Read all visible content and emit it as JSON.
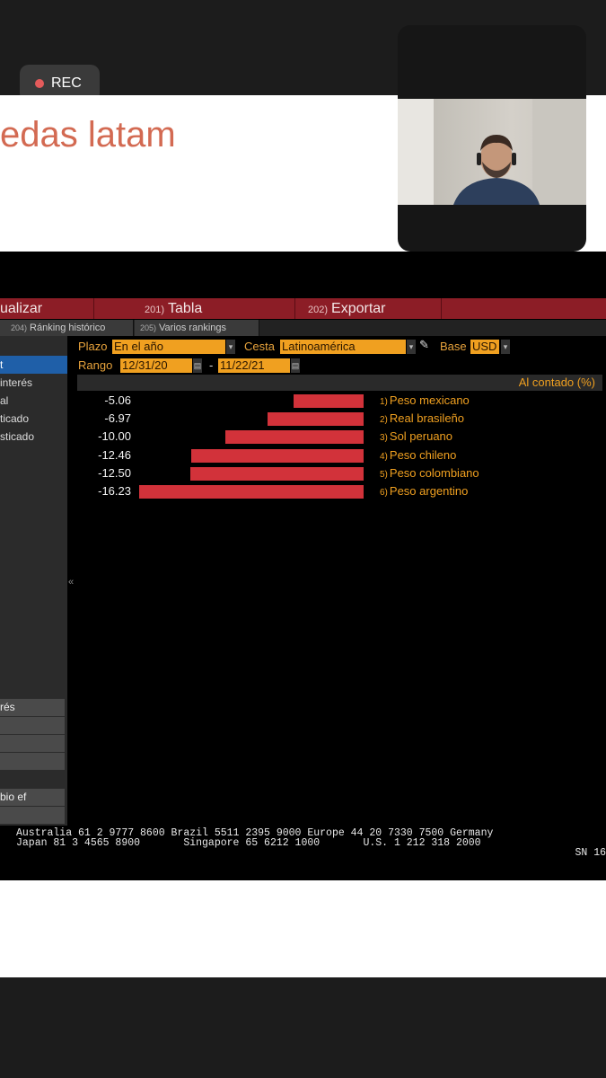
{
  "recording": {
    "label": "REC"
  },
  "slide": {
    "title": "edas latam"
  },
  "menubar": [
    {
      "label": "ualizar"
    },
    {
      "num": "201)",
      "label": "Tabla"
    },
    {
      "num": "202)",
      "label": "Exportar"
    }
  ],
  "tabs": [
    {
      "num": "204)",
      "label": "Ránking histórico"
    },
    {
      "num": "205)",
      "label": "Varios rankings"
    }
  ],
  "sidebar": {
    "items": [
      "t",
      "interés",
      "al",
      "ticado",
      "sticado"
    ],
    "selected_index": 0,
    "buttons": [
      "rés",
      "",
      "",
      "",
      "bio ef",
      ""
    ]
  },
  "filters": {
    "plazo_label": "Plazo",
    "plazo_value": "En el año",
    "cesta_label": "Cesta",
    "cesta_value": "Latinoamérica",
    "base_label": "Base",
    "base_value": "USD",
    "rango_label": "Rango",
    "rango_from": "12/31/20",
    "rango_sep": "-",
    "rango_to": "11/22/21"
  },
  "table": {
    "column_header": "Al contado (%)"
  },
  "chart_data": {
    "type": "bar",
    "orientation": "horizontal",
    "column_header": "Al contado (%)",
    "categories": [
      "Peso mexicano",
      "Real brasileño",
      "Sol peruano",
      "Peso chileno",
      "Peso colombiano",
      "Peso argentino"
    ],
    "ranks": [
      "1)",
      "2)",
      "3)",
      "4)",
      "5)",
      "6)"
    ],
    "values": [
      -5.06,
      -6.97,
      -10.0,
      -12.46,
      -12.5,
      -16.23
    ],
    "value_labels": [
      "-5.06",
      "-6.97",
      "-10.00",
      "-12.46",
      "-12.50",
      "-16.23"
    ],
    "bar_color": "#d2323a",
    "label_color": "#f0a020"
  },
  "footer": {
    "line1": "Australia 61 2 9777 8600 Brazil 5511 2395 9000 Europe 44 20 7330 7500 Germany",
    "line2": "Japan 81 3 4565 8900       Singapore 65 6212 1000       U.S. 1 212 318 2000",
    "line3": "SN 16"
  },
  "colors": {
    "accent_red": "#8c1d26",
    "amber": "#f0a020",
    "title_orange": "#d36a52"
  }
}
